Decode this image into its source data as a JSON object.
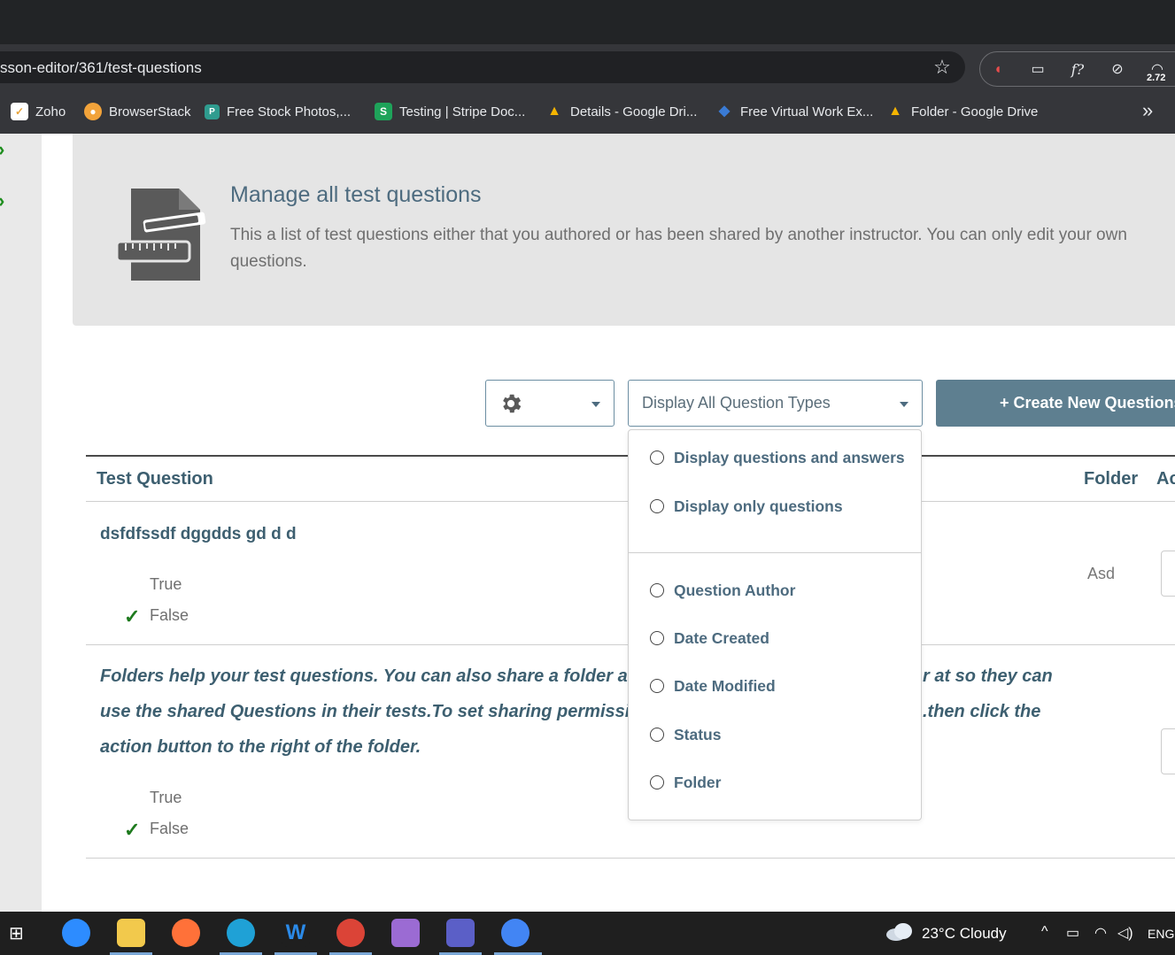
{
  "browser": {
    "url": "sson-editor/361/test-questions",
    "ext_badge": "2.72",
    "bookmarks": [
      {
        "label": "Zoho",
        "icon": "zoho-icon",
        "color": "#e8a33a"
      },
      {
        "label": "BrowserStack",
        "icon": "browserstack-icon",
        "color": "#f2a33a"
      },
      {
        "label": "Free Stock Photos,...",
        "icon": "stock-photos-icon",
        "color": "#2f9c8f"
      },
      {
        "label": "Testing | Stripe Doc...",
        "icon": "stripe-s-icon",
        "color": "#1ea35a"
      },
      {
        "label": "Details - Google Dri...",
        "icon": "google-drive-icon",
        "color": "#f4b400"
      },
      {
        "label": "Free Virtual Work Ex...",
        "icon": "virtual-work-icon",
        "color": "#3a7bd5"
      },
      {
        "label": "Folder - Google Drive",
        "icon": "google-drive-icon",
        "color": "#f4b400"
      }
    ]
  },
  "banner": {
    "title": "Manage all test questions",
    "description": "This a list of test questions either that you authored or has been shared by another instructor. You can only edit your own questions."
  },
  "toolbar": {
    "question_type_value": "Display All Question Types",
    "create_label": "+ Create New Questions"
  },
  "dropdown": {
    "group1": [
      "Display questions and answers",
      "Display only questions"
    ],
    "group2": [
      "Question Author",
      "Date Created",
      "Date Modified",
      "Status",
      "Folder"
    ]
  },
  "table": {
    "headers": {
      "question": "Test Question",
      "folder": "Folder",
      "action": "Ac"
    },
    "rows": [
      {
        "question": "dsfdfssdf dggdds gd d d",
        "answers": [
          "True",
          "False"
        ],
        "correct": "False",
        "folder": "Asd"
      },
      {
        "question_lines": [
          "Folders help your test questions. You can also share a folder a",
          "use the shared Questions in their tests.To set sharing permissi",
          "action button to the right of the folder."
        ],
        "question_tail_lines": [
          "r at so they can",
          ".then click the"
        ],
        "answers": [
          "True",
          "False"
        ],
        "correct": "False",
        "folder": ""
      }
    ]
  },
  "taskbar": {
    "weather": "23°C  Cloudy",
    "language": "ENG"
  },
  "colors": {
    "accent": "#4d6b7f",
    "button": "#5e7f90",
    "check": "#1e7a1e"
  }
}
